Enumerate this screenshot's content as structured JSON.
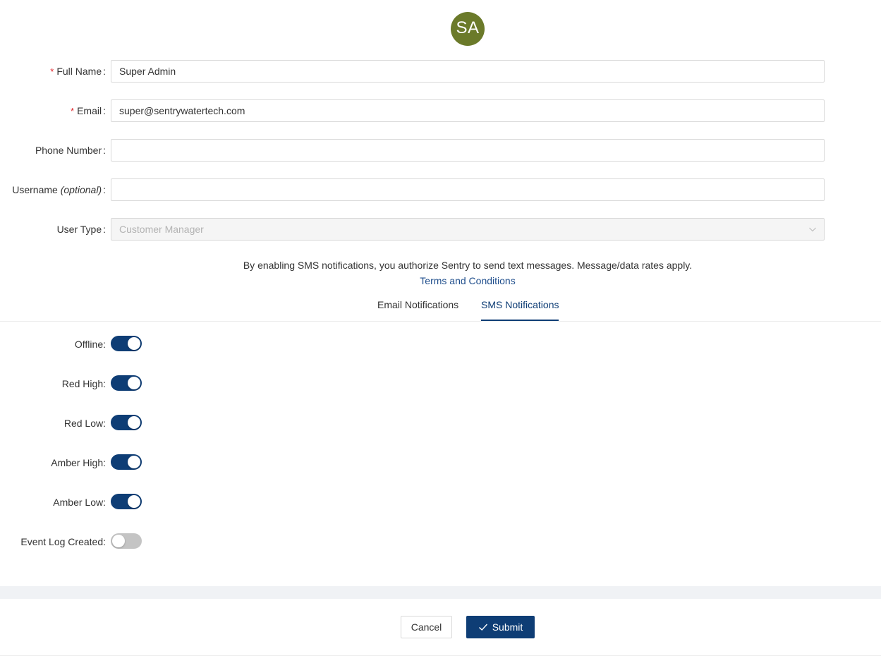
{
  "avatar": {
    "initials": "SA",
    "color": "#6b7a2a"
  },
  "form": {
    "full_name": {
      "label": "Full Name",
      "required": true,
      "value": "Super Admin"
    },
    "email": {
      "label": "Email",
      "required": true,
      "value": "super@sentrywatertech.com"
    },
    "phone": {
      "label": "Phone Number",
      "value": ""
    },
    "username": {
      "label": "Username",
      "label_suffix": "(optional)",
      "value": ""
    },
    "user_type": {
      "label": "User Type",
      "value": "Customer Manager",
      "disabled": true
    },
    "required_mark": "*",
    "colon": ":"
  },
  "sms_notice": {
    "text": "By enabling SMS notifications, you authorize Sentry to send text messages. Message/data rates apply.",
    "link": "Terms and Conditions"
  },
  "tabs": [
    {
      "label": "Email Notifications",
      "active": false
    },
    {
      "label": "SMS Notifications",
      "active": true
    }
  ],
  "toggles": [
    {
      "label": "Offline",
      "on": true
    },
    {
      "label": "Red High",
      "on": true
    },
    {
      "label": "Red Low",
      "on": true
    },
    {
      "label": "Amber High",
      "on": true
    },
    {
      "label": "Amber Low",
      "on": true
    },
    {
      "label": "Event Log Created",
      "on": false
    }
  ],
  "buttons": {
    "cancel": "Cancel",
    "submit": "Submit"
  },
  "colors": {
    "primary": "#0e3d75",
    "required": "#e0282e",
    "toggle_off": "#c4c4c4"
  }
}
